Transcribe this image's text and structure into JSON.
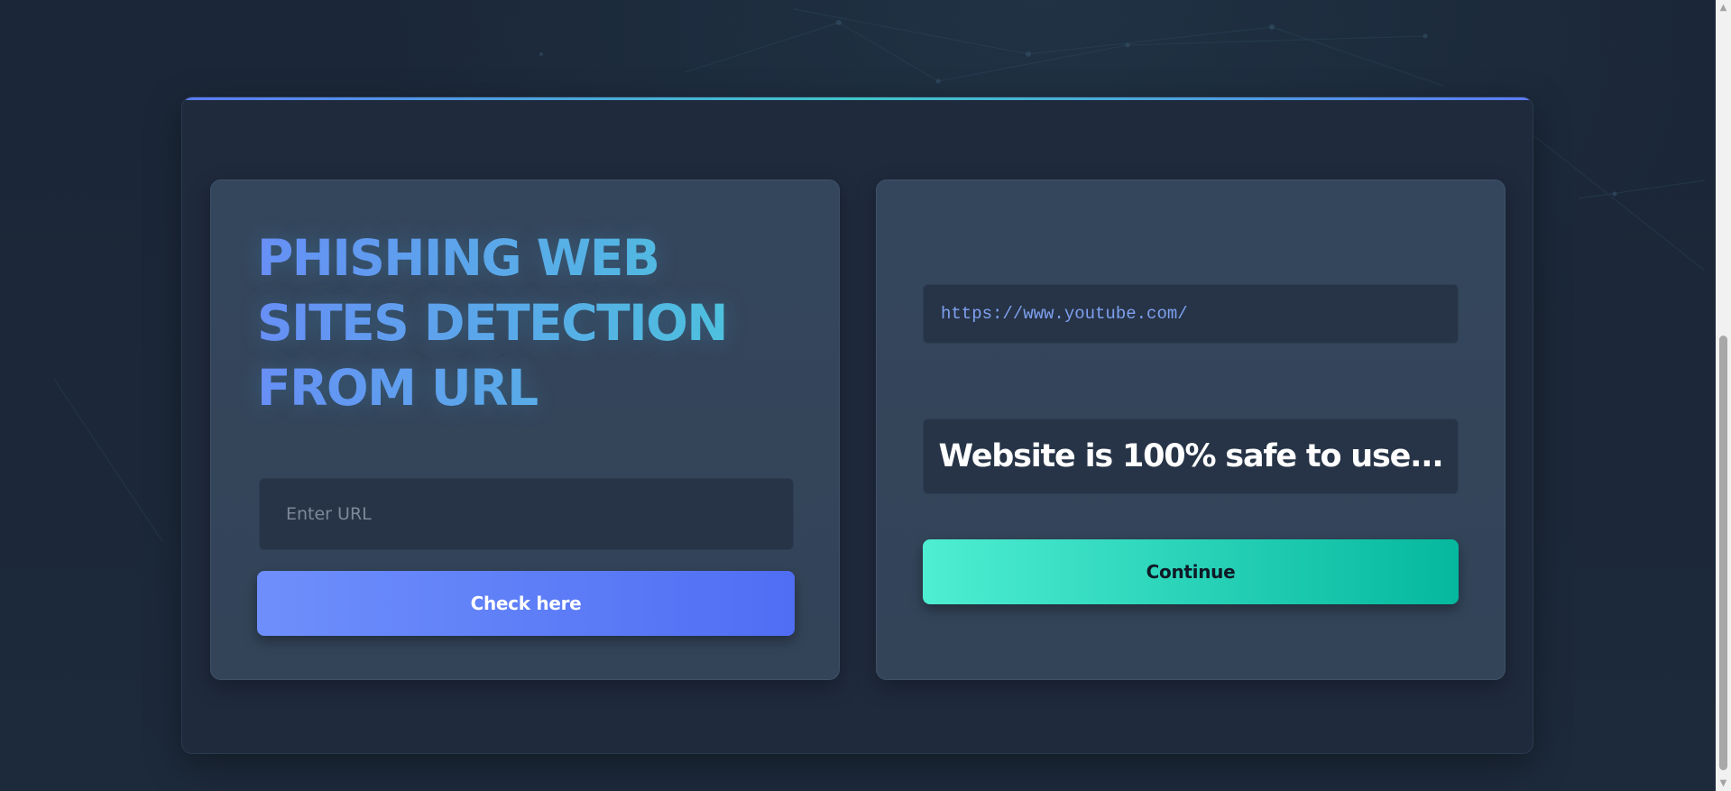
{
  "detector": {
    "title": "PHISHING WEB SITES DETECTION FROM URL",
    "input_placeholder": "Enter URL",
    "input_value": "",
    "check_button_label": "Check here"
  },
  "result": {
    "checked_url": "https://www.youtube.com/",
    "message": "Website is 100% safe to use...",
    "continue_button_label": "Continue"
  },
  "scrollbar": {
    "up_icon": "chevron-up-icon",
    "down_icon": "chevron-down-icon",
    "up_glyph": "▲",
    "down_glyph": "▼"
  },
  "colors": {
    "background": "#1a2536",
    "card": "#34465c",
    "title_gradient_start": "#6b8df8",
    "title_gradient_end": "#4dc8dc",
    "check_button": "#5b7cf6",
    "continue_button": "#1fd4b6",
    "url_text": "#7ea0f0"
  }
}
